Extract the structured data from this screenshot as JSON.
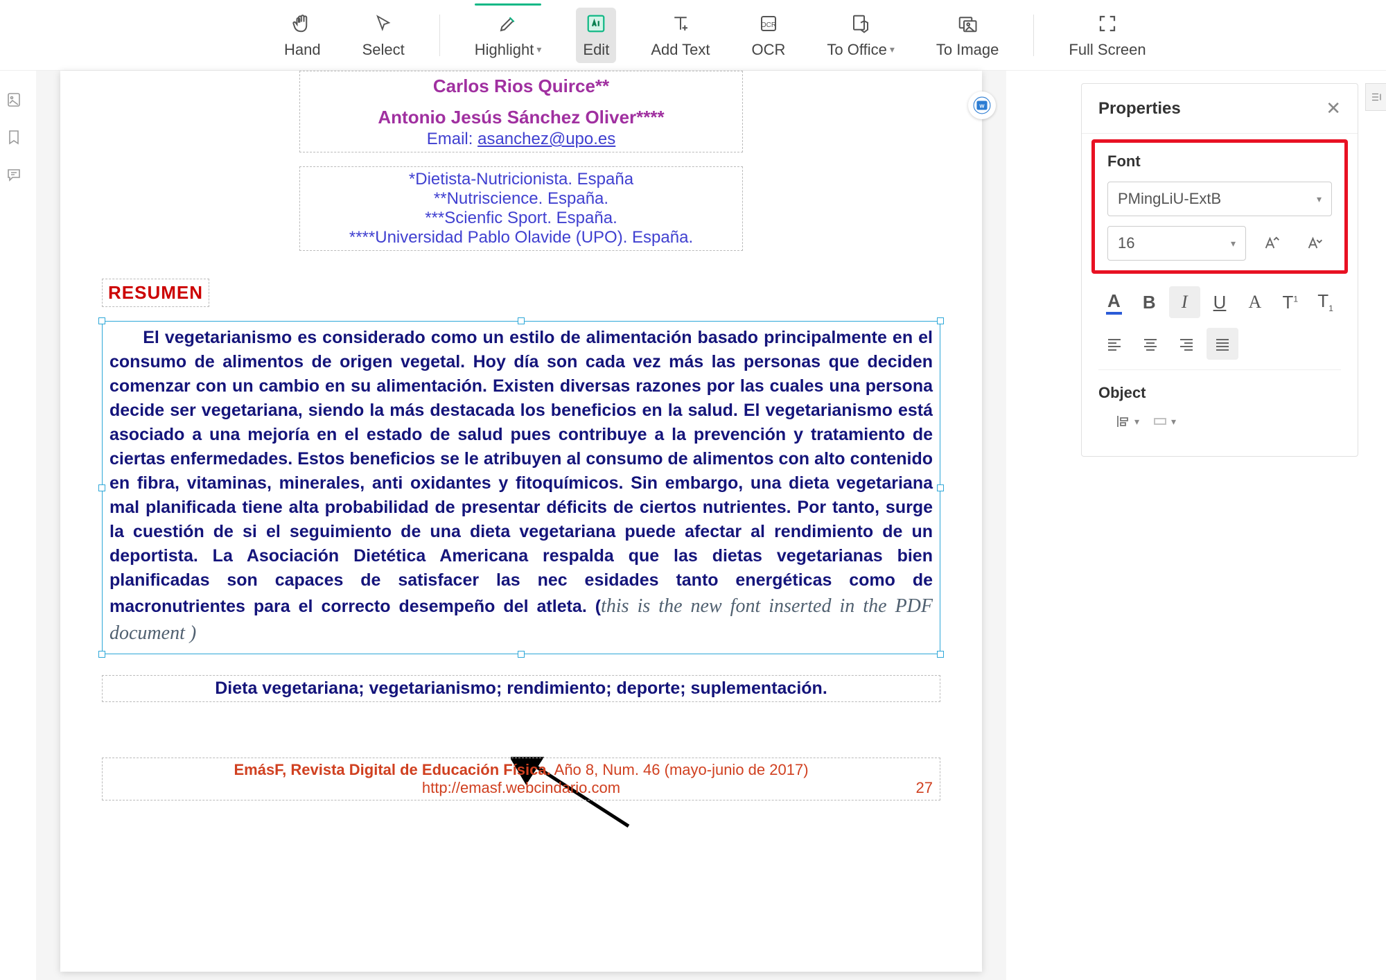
{
  "toolbar": {
    "hand": "Hand",
    "select": "Select",
    "highlight": "Highlight",
    "edit": "Edit",
    "add_text": "Add Text",
    "ocr": "OCR",
    "to_office": "To Office",
    "to_image": "To Image",
    "full_screen": "Full Screen"
  },
  "document": {
    "author1": "Carlos Rios Quirce**",
    "author2": "Antonio Jesús Sánchez Oliver****",
    "email_label": "Email: ",
    "email": "asanchez@upo.es",
    "affil1": "*Dietista-Nutricionista. España",
    "affil2": "**Nutriscience. España.",
    "affil3": "***Scienfic Sport. España.",
    "affil4": "****Universidad Pablo Olavide (UPO). España.",
    "resumen": "RESUMEN",
    "body_main": "El vegetarianismo es considerado como un estilo de alimentación basado principalmente en el consumo de alimentos de origen vegetal. Hoy día son cada vez más las personas que deciden comenzar con un cambio en su alimentación. Existen diversas razones por las cuales una persona decide ser vegetariana,  siendo la más destacada los beneficios en la salud. El vegetarianismo está  asociado a  una mejoría en el estado de salud pues contribuye a la prevención  y  tratamiento de ciertas enfermedades. Estos beneficios se le atribuyen al  consumo de alimentos con alto contenido en fibra, vitaminas, minerales, anti oxidantes y fitoquímicos.  Sin embargo, una dieta vegetariana mal planificada tiene alta probabilidad de presentar déficits de ciertos nutrientes. Por tanto, surge la cuestión de si el seguimiento de una dieta vegetariana puede afectar al rendimiento de  un deportista. La Asociación Dietética  Americana  respalda que las dietas vegetarianas bien planificadas son capaces de satisfacer  las nec esidades tanto energéticas como de macronutrientes para el  correcto desempeño del atleta. (",
    "body_insert": "this is the new  font inserted in   the  PDF document    )",
    "keywords": "Dieta vegetariana; vegetarianismo; rendimiento; deporte; suplementación.",
    "footer_bold": "EmásF, Revista Digital de Educación Física.",
    "footer_rest": " Año 8, Num. 46 (mayo-junio de 2017)",
    "footer_url": "http://emasf.webcindario.com",
    "page_num": "27"
  },
  "panel": {
    "title": "Properties",
    "font_section": "Font",
    "font_family": "PMingLiU-ExtB",
    "font_size": "16",
    "object_section": "Object"
  }
}
